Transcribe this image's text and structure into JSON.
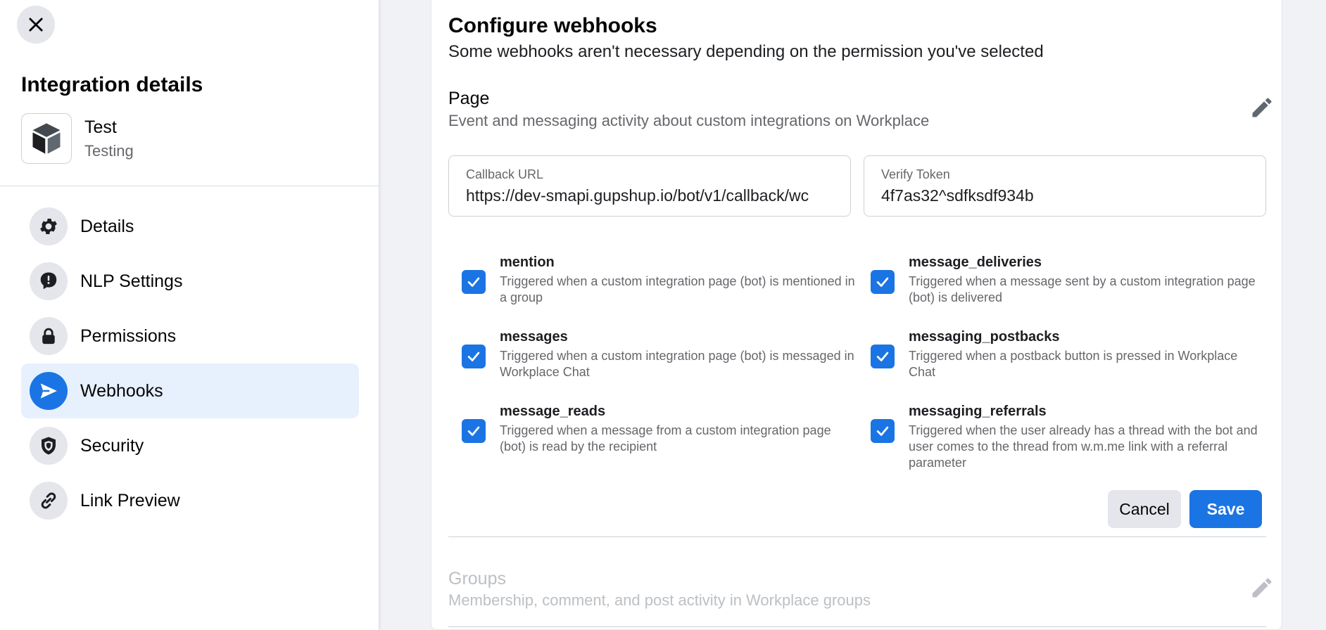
{
  "sidebar": {
    "title": "Integration details",
    "app": {
      "name": "Test",
      "subtitle": "Testing"
    },
    "items": [
      {
        "label": "Details",
        "icon": "gear-icon"
      },
      {
        "label": "NLP Settings",
        "icon": "chat-alert-icon"
      },
      {
        "label": "Permissions",
        "icon": "lock-icon"
      },
      {
        "label": "Webhooks",
        "icon": "send-icon",
        "active": true
      },
      {
        "label": "Security",
        "icon": "shield-icon"
      },
      {
        "label": "Link Preview",
        "icon": "link-icon"
      }
    ]
  },
  "main": {
    "title": "Configure webhooks",
    "subtitle": "Some webhooks aren't necessary depending on the permission you've selected",
    "page_section": {
      "title": "Page",
      "description": "Event and messaging activity about custom integrations on Workplace",
      "callback_url": {
        "label": "Callback URL",
        "value": "https://dev-smapi.gupshup.io/bot/v1/callback/wc"
      },
      "verify_token": {
        "label": "Verify Token",
        "value": "4f7as32^sdfksdf934b"
      },
      "webhooks": [
        {
          "name": "mention",
          "description": "Triggered when a custom integration page (bot) is mentioned in a group",
          "checked": true
        },
        {
          "name": "message_deliveries",
          "description": "Triggered when a message sent by a custom integration page (bot) is delivered",
          "checked": true
        },
        {
          "name": "messages",
          "description": "Triggered when a custom integration page (bot) is messaged in Workplace Chat",
          "checked": true
        },
        {
          "name": "messaging_postbacks",
          "description": "Triggered when a postback button is pressed in Workplace Chat",
          "checked": true
        },
        {
          "name": "message_reads",
          "description": "Triggered when a message from a custom integration page (bot) is read by the recipient",
          "checked": true
        },
        {
          "name": "messaging_referrals",
          "description": "Triggered when the user already has a thread with the bot and user comes to the thread from w.m.me link with a referral parameter",
          "checked": true
        }
      ],
      "cancel_label": "Cancel",
      "save_label": "Save"
    },
    "groups_section": {
      "title": "Groups",
      "description": "Membership, comment, and post activity in Workplace groups"
    }
  },
  "colors": {
    "accent": "#1b74e4",
    "active_bg": "#e7f0fd",
    "icon_bg": "#e4e6eb"
  }
}
